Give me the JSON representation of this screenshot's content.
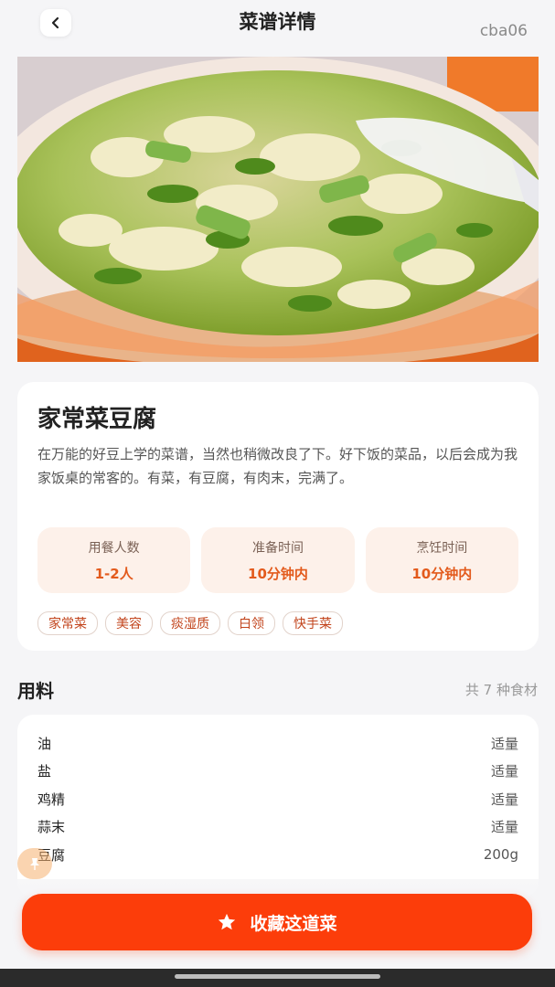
{
  "header": {
    "title": "菜谱详情",
    "watermark": "cba06",
    "back_icon": "chevron-left-icon"
  },
  "recipe": {
    "name": "家常菜豆腐",
    "description": "在万能的好豆上学的菜谱，当然也稍微改良了下。好下饭的菜品，以后会成为我家饭桌的常客的。有菜，有豆腐，有肉末，完满了。",
    "stats": [
      {
        "label": "用餐人数",
        "value": "1-2人"
      },
      {
        "label": "准备时间",
        "value": "10分钟内"
      },
      {
        "label": "烹饪时间",
        "value": "10分钟内"
      }
    ],
    "tags": [
      "家常菜",
      "美容",
      "痰湿质",
      "白领",
      "快手菜"
    ]
  },
  "ingredients": {
    "title": "用料",
    "count_text": "共 7 种食材",
    "items": [
      {
        "name": "油",
        "amount": "适量"
      },
      {
        "name": "盐",
        "amount": "适量"
      },
      {
        "name": "鸡精",
        "amount": "适量"
      },
      {
        "name": "蒜末",
        "amount": "适量"
      },
      {
        "name": "豆腐",
        "amount": "200g"
      }
    ]
  },
  "footer": {
    "favorite_label": "收藏这道菜",
    "favorite_icon": "star-icon"
  },
  "colors": {
    "accent": "#fc3d0a",
    "stat_bg": "#fdf1ea",
    "stat_value": "#e35a1c",
    "tag_text": "#c2441c"
  }
}
